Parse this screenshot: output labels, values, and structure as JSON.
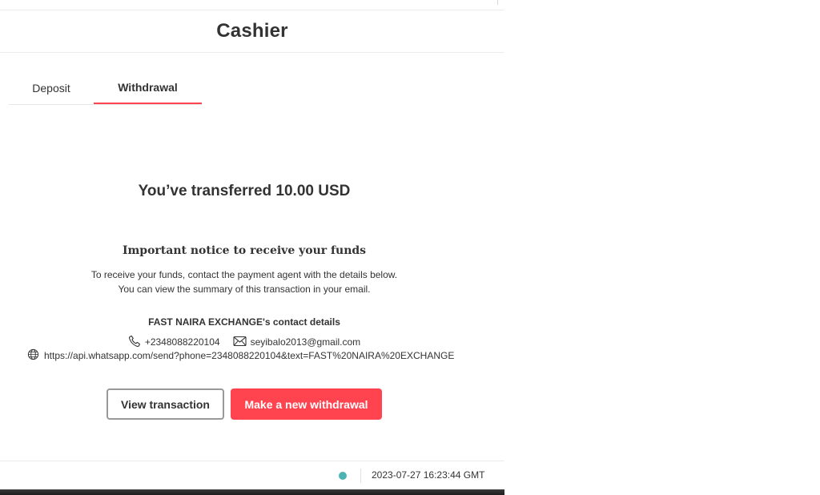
{
  "header": {
    "title": "Cashier"
  },
  "tabs": [
    {
      "label": "Deposit",
      "active": false
    },
    {
      "label": "Withdrawal",
      "active": true
    }
  ],
  "result": {
    "transferred_text": "You’ve transferred 10.00 USD"
  },
  "notice": {
    "title": "Important notice to receive your funds",
    "line1": "To receive your funds, contact the payment agent with the details below.",
    "line2": "You can view the summary of this transaction in your email."
  },
  "agent": {
    "title": "FAST NAIRA EXCHANGE's contact details",
    "phone": "+2348088220104",
    "email": "seyibalo2013@gmail.com",
    "url": "https://api.whatsapp.com/send?phone=2348088220104&text=FAST%20NAIRA%20EXCHANGE"
  },
  "buttons": {
    "view_transaction": "View transaction",
    "new_withdrawal": "Make a new withdrawal"
  },
  "footer": {
    "timestamp": "2023-07-27 16:23:44 GMT",
    "status_color": "#4bb4b3"
  },
  "colors": {
    "accent": "#ff444f",
    "text": "#333333"
  },
  "icons": {
    "phone": "phone-icon",
    "email": "email-icon",
    "globe": "globe-icon"
  }
}
